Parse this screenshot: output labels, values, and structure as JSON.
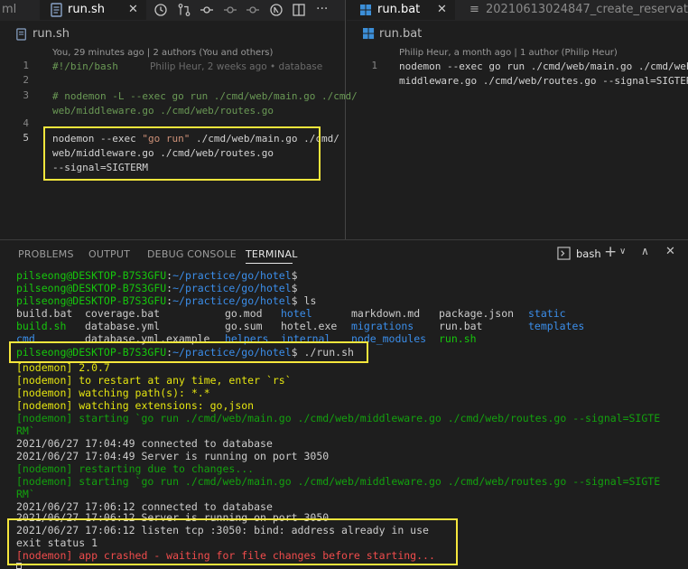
{
  "left_tabs": [
    {
      "label": "ml",
      "active": false
    },
    {
      "label": "run.sh",
      "active": true
    }
  ],
  "right_tabs": [
    {
      "label": "run.bat",
      "active": true
    },
    {
      "label": "20210613024847_create_reservat",
      "active": false
    }
  ],
  "toolbar_icons": [
    "history-icon",
    "compare-changes-icon",
    "git-commit-previous-icon",
    "git-commit-icon",
    "git-commit-next-icon",
    "open-changes-icon",
    "split-editor-icon",
    "more-actions-icon"
  ],
  "left_editor": {
    "breadcrumb": "run.sh",
    "blame_header": "You, 29 minutes ago | 2 authors (You and others)",
    "lines": [
      {
        "num": "1",
        "text": "#!/bin/bash",
        "ghost": "Philip Heur, 2 weeks ago • database"
      },
      {
        "num": "2",
        "text": ""
      },
      {
        "num": "3",
        "text": "# nodemon -L --exec go run ./cmd/web/main.go ./cmd/",
        "cont": "web/middleware.go ./cmd/web/routes.go"
      },
      {
        "num": "4",
        "text": ""
      },
      {
        "num": "5",
        "parts": [
          "nodemon --exec ",
          "\"go run\"",
          " ./cmd/web/main.go ./cmd/"
        ],
        "cont": "web/middleware.go ./cmd/web/routes.go",
        "cont2": "--signal=SIGTERM"
      }
    ]
  },
  "right_editor": {
    "breadcrumb": "run.bat",
    "blame_header": "Philip Heur, a month ago | 1 author (Philip Heur)",
    "lines": [
      {
        "num": "1",
        "text": "nodemon --exec go run ./cmd/web/main.go ./cmd/web/",
        "cont": "middleware.go ./cmd/web/routes.go --signal=SIGTERM"
      }
    ]
  },
  "panel": {
    "tabs": [
      "PROBLEMS",
      "OUTPUT",
      "DEBUG CONSOLE",
      "TERMINAL"
    ],
    "active_tab": "TERMINAL",
    "shell": "bash"
  },
  "terminal": {
    "prompt_user": "pilseong@DESKTOP-B7S3GFU",
    "prompt_path": "~/practice/go/hotel",
    "ls_cmd": " ls",
    "ls_rows": [
      [
        "build.bat",
        "coverage.bat",
        "go.mod",
        "hotel",
        "markdown.md",
        "package.json",
        "static"
      ],
      [
        "build.sh",
        "database.yml",
        "go.sum",
        "hotel.exe",
        "migrations",
        "run.bat",
        "templates"
      ],
      [
        "cmd",
        "database.yml.example",
        "helpers",
        "internal",
        "node_modules",
        "run.sh",
        ""
      ]
    ],
    "run_cmd": " ./run.sh",
    "nodemon_version": "[nodemon] 2.0.7",
    "nodemon_restart": "[nodemon] to restart at any time, enter `rs`",
    "nodemon_watch": "[nodemon] watching path(s): *.*",
    "nodemon_ext": "[nodemon] watching extensions: go,json",
    "starting_1": "[nodemon] starting `go run ./cmd/web/main.go ./cmd/web/middleware.go ./cmd/web/routes.go --signal=SIGTE",
    "starting_1b": "RM`",
    "log1": "2021/06/27 17:04:49 connected to database",
    "log2": "2021/06/27 17:04:49 Server is running on port 3050",
    "restarting": "[nodemon] restarting due to changes...",
    "starting_2": "[nodemon] starting `go run ./cmd/web/main.go ./cmd/web/middleware.go ./cmd/web/routes.go --signal=SIGTE",
    "starting_2b": "RM`",
    "log3": "2021/06/27 17:06:12 connected to database",
    "log4": "2021/06/27 17:06:12 Server is running on port 3050",
    "err1": "2021/06/27 17:06:12 listen tcp :3050: bind: address already in use",
    "err2": "exit status 1",
    "crash": "[nodemon] app crashed - waiting for file changes before starting..."
  }
}
